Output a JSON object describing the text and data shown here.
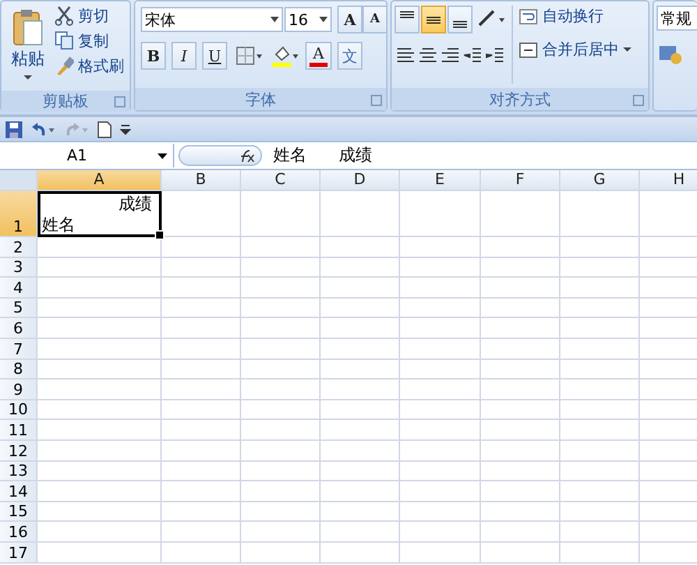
{
  "ribbon": {
    "clipboard": {
      "label": "剪贴板",
      "paste": "粘贴",
      "items": [
        {
          "kind": "cut",
          "label": "剪切"
        },
        {
          "kind": "copy",
          "label": "复制"
        },
        {
          "kind": "brush",
          "label": "格式刷"
        }
      ]
    },
    "font": {
      "label": "字体",
      "font_name": "宋体",
      "font_size": "16",
      "grow": "A",
      "shrink": "A",
      "styles": [
        {
          "kind": "bold",
          "label": "B"
        },
        {
          "kind": "italic",
          "label": "I"
        },
        {
          "kind": "underline",
          "label": "U"
        }
      ],
      "font_color": "A",
      "phonetic": "文"
    },
    "alignment": {
      "label": "对齐方式",
      "vertical": [
        {
          "kind": "top",
          "selected": false
        },
        {
          "kind": "middle",
          "selected": true
        },
        {
          "kind": "bottom",
          "selected": false
        }
      ],
      "wrap": "自动换行",
      "merge": "合并后居中"
    },
    "number": {
      "format": "常规"
    }
  },
  "name_box": "A1",
  "formula": "姓名      成绩",
  "columns": [
    {
      "label": "A",
      "selected": true
    },
    {
      "label": "B",
      "selected": false
    },
    {
      "label": "C",
      "selected": false
    },
    {
      "label": "D",
      "selected": false
    },
    {
      "label": "E",
      "selected": false
    },
    {
      "label": "F",
      "selected": false
    },
    {
      "label": "G",
      "selected": false
    },
    {
      "label": "H",
      "selected": false
    }
  ],
  "rows": [
    {
      "label": "1",
      "selected": true,
      "cells": [
        {
          "top": "成绩",
          "bottom": "姓名"
        }
      ]
    },
    {
      "label": "2",
      "selected": false
    },
    {
      "label": "3",
      "selected": false
    },
    {
      "label": "4",
      "selected": false
    },
    {
      "label": "5",
      "selected": false
    },
    {
      "label": "6",
      "selected": false
    },
    {
      "label": "7",
      "selected": false
    },
    {
      "label": "8",
      "selected": false
    },
    {
      "label": "9",
      "selected": false
    },
    {
      "label": "10",
      "selected": false
    },
    {
      "label": "11",
      "selected": false
    },
    {
      "label": "12",
      "selected": false
    },
    {
      "label": "13",
      "selected": false
    },
    {
      "label": "14",
      "selected": false
    },
    {
      "label": "15",
      "selected": false
    },
    {
      "label": "16",
      "selected": false
    },
    {
      "label": "17",
      "selected": false
    }
  ]
}
